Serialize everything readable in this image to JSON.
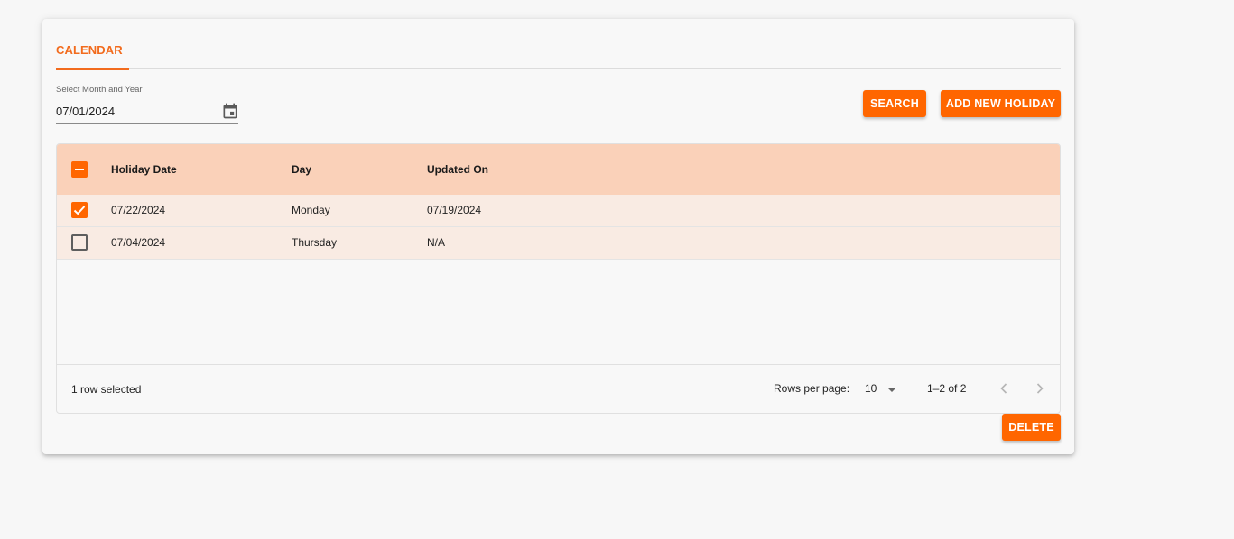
{
  "tabs": [
    {
      "label": "CALENDAR"
    }
  ],
  "date_picker": {
    "label": "Select Month and Year",
    "value": "07/01/2024"
  },
  "buttons": {
    "search": "SEARCH",
    "add_new_holiday": "ADD NEW HOLIDAY",
    "delete": "DELETE"
  },
  "table": {
    "columns": [
      "Holiday Date",
      "Day",
      "Updated On"
    ],
    "rows": [
      {
        "checked": true,
        "holiday_date": "07/22/2024",
        "day": "Monday",
        "updated_on": "07/19/2024"
      },
      {
        "checked": false,
        "holiday_date": "07/04/2024",
        "day": "Thursday",
        "updated_on": "N/A"
      }
    ],
    "header_checkbox": "indeterminate"
  },
  "footer": {
    "selection_text": "1 row selected",
    "rows_per_page_label": "Rows per page:",
    "rows_per_page_value": "10",
    "range_text": "1–2 of 2"
  },
  "icons": {
    "calendar": "calendar-icon",
    "prev": "chevron-left-icon",
    "next": "chevron-right-icon",
    "dropdown": "caret-down-icon"
  },
  "colors": {
    "accent": "#ff6600",
    "tab_text": "#f26b1d",
    "header_bg": "#fad1b9",
    "row_bg": "#f9ebe3"
  }
}
